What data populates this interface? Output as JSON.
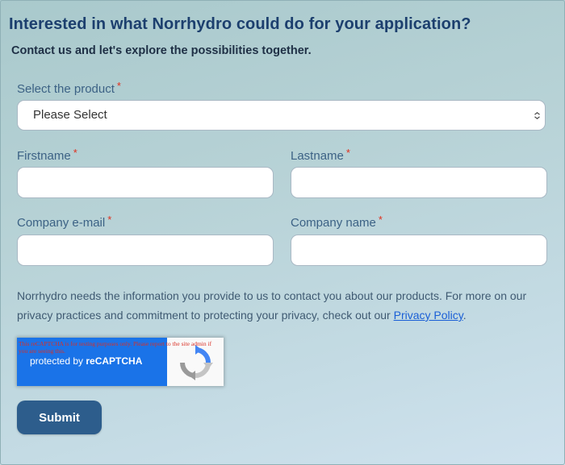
{
  "form": {
    "heading": "Interested in what Norrhydro could do for your application?",
    "subheading": "Contact us and let's explore the possibilities together.",
    "required_marker": "*",
    "fields": {
      "product": {
        "label": "Select the product",
        "selected": "Please Select"
      },
      "firstname": {
        "label": "Firstname",
        "value": ""
      },
      "lastname": {
        "label": "Lastname",
        "value": ""
      },
      "email": {
        "label": "Company e-mail",
        "value": ""
      },
      "company": {
        "label": "Company name",
        "value": ""
      }
    },
    "privacy": {
      "text": "Norrhydro needs the information you provide to us to contact you about our products. For more on our privacy practices and commitment to protecting your privacy, check out our ",
      "link_text": "Privacy Policy",
      "suffix": "."
    },
    "recaptcha": {
      "test_notice": "This reCAPTCHA is for testing purposes only. Please report to the site admin if you are seeing this.",
      "protected_by": "protected by ",
      "brand": "reCAPTCHA",
      "icon": "recaptcha-logo-icon"
    },
    "submit_label": "Submit"
  },
  "colors": {
    "heading": "#1c3f6e",
    "label": "#3c6285",
    "required": "#e0301e",
    "button": "#2d5d8c",
    "recaptcha_badge": "#1a73e8",
    "link": "#1a5fd6"
  }
}
